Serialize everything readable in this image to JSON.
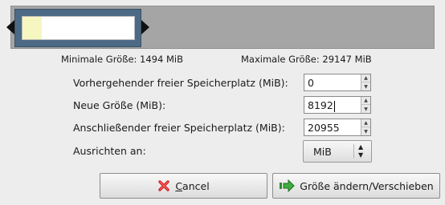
{
  "partition": {
    "used_fraction": 0.17,
    "colors": {
      "background": "#a5a5a5",
      "frame": "#4c6a85",
      "free": "#ffffff",
      "used": "#f6f7c0"
    }
  },
  "limits": {
    "min_label": "Minimale Größe: 1494 MiB",
    "max_label": "Maximale Größe: 29147 MiB"
  },
  "fields": [
    {
      "label": "Vorhergehender freier Speicherplatz (MiB):",
      "value": "0"
    },
    {
      "label": "Neue Größe (MiB):",
      "value": "8192"
    },
    {
      "label": "Anschließender freier Speicherplatz (MiB):",
      "value": "20955"
    }
  ],
  "align": {
    "label": "Ausrichten an:",
    "value": "MiB"
  },
  "buttons": {
    "cancel_underline": "C",
    "cancel_rest": "ancel",
    "apply": "Größe ändern/Verschieben"
  },
  "icons": {
    "cancel": "red-x-icon",
    "apply": "green-arrow-icon"
  }
}
